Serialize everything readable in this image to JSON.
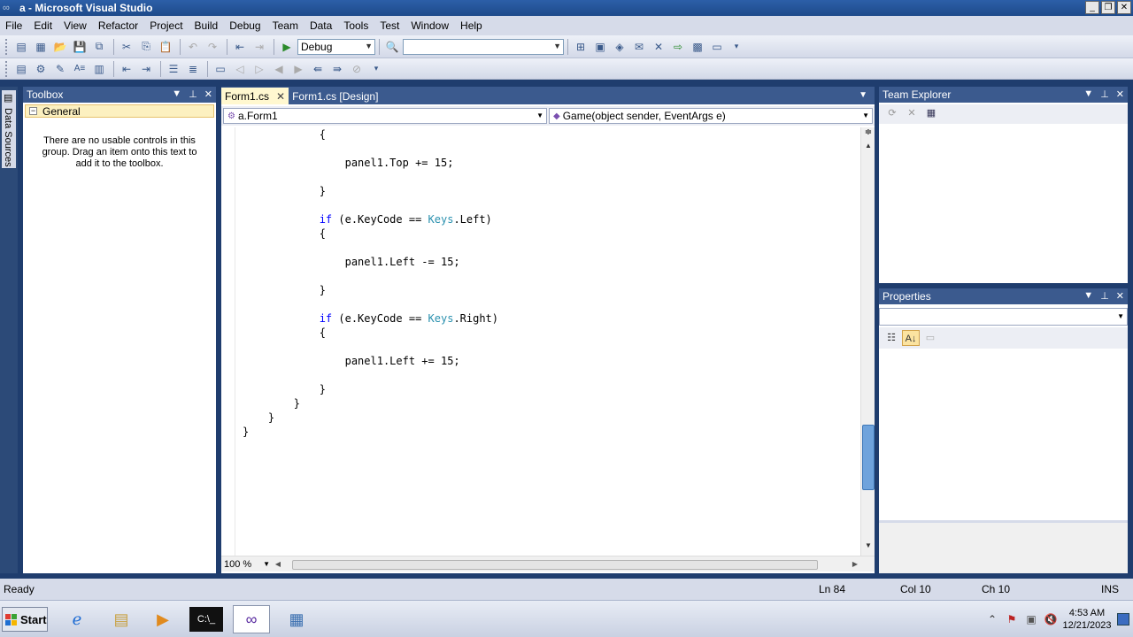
{
  "window": {
    "title": "a - Microsoft Visual Studio"
  },
  "menu": [
    "File",
    "Edit",
    "View",
    "Refactor",
    "Project",
    "Build",
    "Debug",
    "Team",
    "Data",
    "Tools",
    "Test",
    "Window",
    "Help"
  ],
  "toolbar": {
    "config": "Debug",
    "platform": ""
  },
  "left_strip": {
    "tab": "Data Sources"
  },
  "toolbox": {
    "title": "Toolbox",
    "group": "General",
    "empty_message": "There are no usable controls in this group. Drag an item onto this text to add it to the toolbox."
  },
  "editor": {
    "tabs": [
      {
        "label": "Form1.cs",
        "active": true
      },
      {
        "label": "Form1.cs [Design]",
        "active": false
      }
    ],
    "class_combo": "a.Form1",
    "member_combo": "Game(object sender, EventArgs e)",
    "zoom": "100 %",
    "lines": [
      {
        "parts": [
          {
            "t": "            {",
            "c": ""
          }
        ]
      },
      {
        "parts": [
          {
            "t": "",
            "c": ""
          }
        ]
      },
      {
        "parts": [
          {
            "t": "                panel1.Top += 15;",
            "c": ""
          }
        ]
      },
      {
        "parts": [
          {
            "t": "",
            "c": ""
          }
        ]
      },
      {
        "parts": [
          {
            "t": "            }",
            "c": ""
          }
        ]
      },
      {
        "parts": [
          {
            "t": "",
            "c": ""
          }
        ]
      },
      {
        "parts": [
          {
            "t": "            ",
            "c": ""
          },
          {
            "t": "if",
            "c": "kw"
          },
          {
            "t": " (e.KeyCode == ",
            "c": ""
          },
          {
            "t": "Keys",
            "c": "ty"
          },
          {
            "t": ".Left)",
            "c": ""
          }
        ]
      },
      {
        "parts": [
          {
            "t": "            {",
            "c": ""
          }
        ]
      },
      {
        "parts": [
          {
            "t": "",
            "c": ""
          }
        ]
      },
      {
        "parts": [
          {
            "t": "                panel1.Left -= 15;",
            "c": ""
          }
        ]
      },
      {
        "parts": [
          {
            "t": "",
            "c": ""
          }
        ]
      },
      {
        "parts": [
          {
            "t": "            }",
            "c": ""
          }
        ]
      },
      {
        "parts": [
          {
            "t": "",
            "c": ""
          }
        ]
      },
      {
        "parts": [
          {
            "t": "            ",
            "c": ""
          },
          {
            "t": "if",
            "c": "kw"
          },
          {
            "t": " (e.KeyCode == ",
            "c": ""
          },
          {
            "t": "Keys",
            "c": "ty"
          },
          {
            "t": ".Right)",
            "c": ""
          }
        ]
      },
      {
        "parts": [
          {
            "t": "            {",
            "c": ""
          }
        ]
      },
      {
        "parts": [
          {
            "t": "",
            "c": ""
          }
        ]
      },
      {
        "parts": [
          {
            "t": "                panel1.Left += 15;",
            "c": ""
          }
        ]
      },
      {
        "parts": [
          {
            "t": "",
            "c": ""
          }
        ]
      },
      {
        "parts": [
          {
            "t": "            }",
            "c": ""
          }
        ]
      },
      {
        "parts": [
          {
            "t": "        }",
            "c": ""
          }
        ]
      },
      {
        "parts": [
          {
            "t": "    }",
            "c": ""
          }
        ]
      },
      {
        "parts": [
          {
            "t": "}",
            "c": ""
          }
        ]
      }
    ]
  },
  "team_explorer": {
    "title": "Team Explorer"
  },
  "properties": {
    "title": "Properties"
  },
  "status": {
    "text": "Ready",
    "ln": "Ln 84",
    "col": "Col 10",
    "ch": "Ch 10",
    "mode": "INS"
  },
  "taskbar": {
    "start": "Start",
    "time": "4:53 AM",
    "date": "12/21/2023"
  },
  "colors": {
    "keyword": "#0000ff",
    "type": "#2b91af",
    "panel_header": "#3b5a8e",
    "active_tab": "#fff8d0"
  }
}
